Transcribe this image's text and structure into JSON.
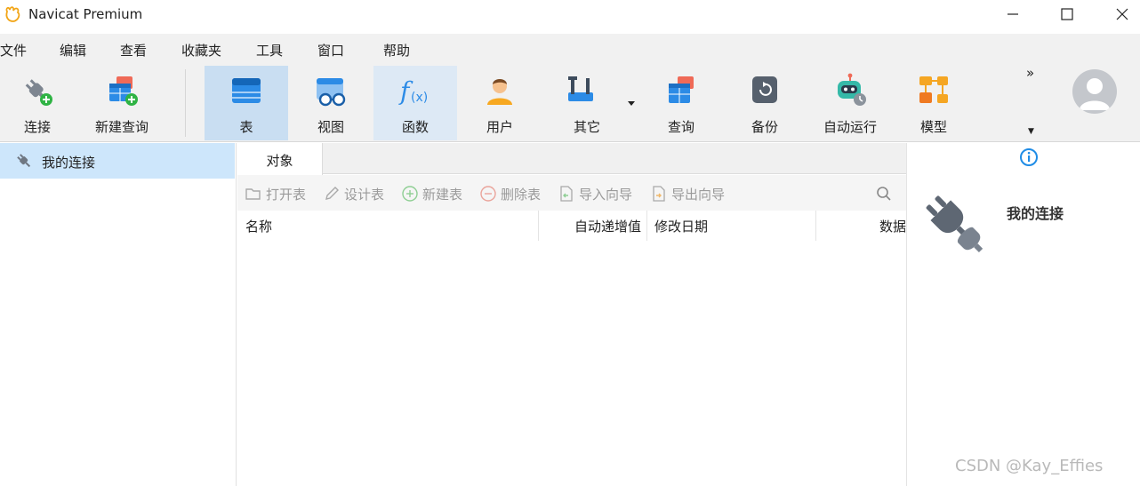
{
  "window": {
    "title": "Navicat Premium",
    "controls": [
      "minimize-icon",
      "maximize-icon",
      "close-icon"
    ]
  },
  "menu": {
    "items": [
      "文件",
      "编辑",
      "查看",
      "收藏夹",
      "工具",
      "窗口",
      "帮助"
    ]
  },
  "toolbar": {
    "connect_label": "连接",
    "new_query_label": "新建查询",
    "table_label": "表",
    "view_label": "视图",
    "function_label": "函数",
    "user_label": "用户",
    "other_label": "其它",
    "query_label": "查询",
    "backup_label": "备份",
    "automation_label": "自动运行",
    "model_label": "模型",
    "more_label": "»",
    "active_tab": "表"
  },
  "sidebar": {
    "connection_name": "我的连接"
  },
  "objects": {
    "tab_label": "对象",
    "actions": {
      "open_table": "打开表",
      "design_table": "设计表",
      "new_table": "新建表",
      "delete_table": "删除表",
      "import_wizard": "导入向导",
      "export_wizard": "导出向导"
    },
    "columns": [
      "名称",
      "自动递增值",
      "修改日期",
      "数据"
    ]
  },
  "info_panel": {
    "connection_name": "我的连接"
  },
  "watermark": "CSDN @Kay_Effies",
  "colors": {
    "active_tab_bg": "#c9def2",
    "selection_bg": "#cde6fb",
    "accent_blue": "#1f8ce6",
    "toolbar_bg": "#f1f1f1"
  }
}
